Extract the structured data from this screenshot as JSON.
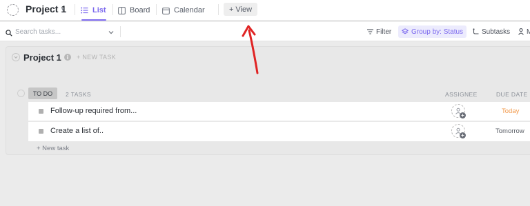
{
  "header": {
    "project_title": "Project 1",
    "tabs": [
      {
        "label": "List",
        "active": true
      },
      {
        "label": "Board",
        "active": false
      },
      {
        "label": "Calendar",
        "active": false
      }
    ],
    "add_view_label": "+ View"
  },
  "toolbar": {
    "search_placeholder": "Search tasks...",
    "filter_label": "Filter",
    "group_by_label": "Group by: Status",
    "subtasks_label": "Subtasks",
    "more_label": "M"
  },
  "list": {
    "title": "Project 1",
    "new_task_label": "+ NEW TASK",
    "status_group": {
      "status": "TO DO",
      "count_label": "2 TASKS",
      "columns": [
        "ASSIGNEE",
        "DUE DATE"
      ],
      "tasks": [
        {
          "name": "Follow-up required from...",
          "due": "Today",
          "due_color": "#f2994a"
        },
        {
          "name": "Create a list of..",
          "due": "Tomorrow",
          "due_color": "#5b6068"
        }
      ],
      "add_task_label": "+ New task"
    }
  },
  "colors": {
    "accent": "#7b68ee",
    "annotation_arrow": "#e02424"
  }
}
